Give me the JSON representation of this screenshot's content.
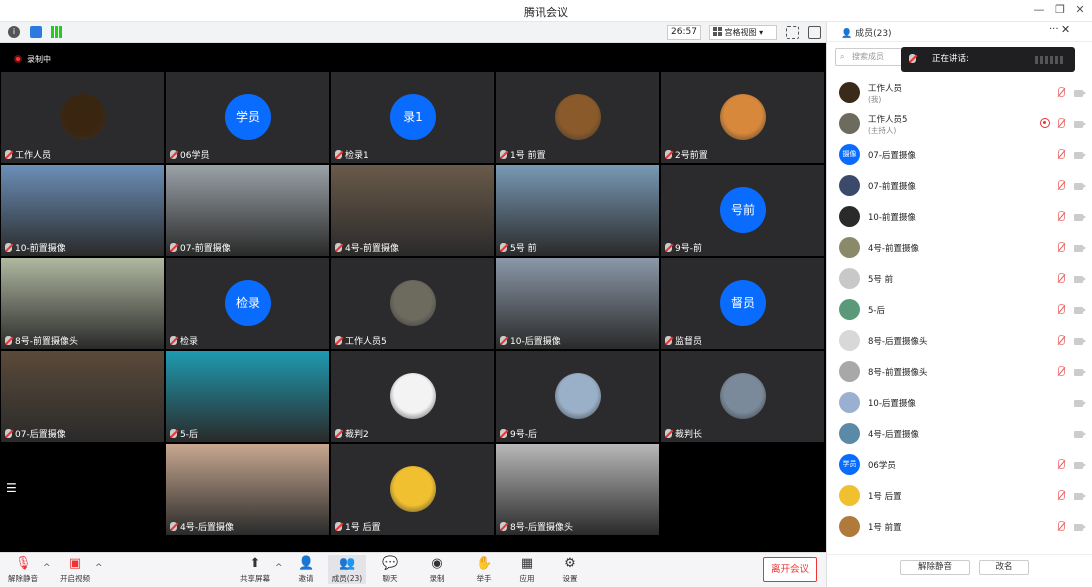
{
  "window": {
    "title": "腾讯会议"
  },
  "toolbar": {
    "timer": "26:57",
    "view_label": "宫格视图"
  },
  "recording": {
    "label": "录制中"
  },
  "tiles": [
    {
      "name": "工作人员",
      "kind": "photo",
      "color": "#3a2510"
    },
    {
      "name": "06学员",
      "kind": "circle",
      "text": "学员"
    },
    {
      "name": "检录1",
      "kind": "circle",
      "text": "录1"
    },
    {
      "name": "1号 前置",
      "kind": "photo",
      "color": "#8a5a2a"
    },
    {
      "name": "2号前置",
      "kind": "photo",
      "color": "#d8883a"
    },
    {
      "name": "10-前置摄像",
      "kind": "video",
      "color": "#6b8fb8"
    },
    {
      "name": "07-前置摄像",
      "kind": "video",
      "color": "#9aa2a8"
    },
    {
      "name": "4号-前置摄像",
      "kind": "video",
      "color": "#6a5a4a"
    },
    {
      "name": "5号  前",
      "kind": "video",
      "color": "#7899b5"
    },
    {
      "name": "9号-前",
      "kind": "circle",
      "text": "号前"
    },
    {
      "name": "8号-前置摄像头",
      "kind": "video",
      "color": "#b0b8a0"
    },
    {
      "name": "检录",
      "kind": "circle",
      "text": "检录"
    },
    {
      "name": "工作人员5",
      "kind": "photo",
      "color": "#6d6a5e"
    },
    {
      "name": "10-后置摄像",
      "kind": "video",
      "color": "#8a98a8"
    },
    {
      "name": "监督员",
      "kind": "circle",
      "text": "督员"
    },
    {
      "name": "07-后置摄像",
      "kind": "video",
      "color": "#5a4a3a"
    },
    {
      "name": "5-后",
      "kind": "video",
      "color": "#1e9ab0"
    },
    {
      "name": "裁判2",
      "kind": "photo",
      "color": "#f3f3f3"
    },
    {
      "name": "9号-后",
      "kind": "photo",
      "color": "#9ab0c8"
    },
    {
      "name": "裁判长",
      "kind": "photo",
      "color": "#7a8a9a"
    },
    {
      "name": "",
      "kind": "empty"
    },
    {
      "name": "4号-后置摄像",
      "kind": "video",
      "color": "#c8a890"
    },
    {
      "name": "1号 后置",
      "kind": "photo",
      "color": "#f0c030"
    },
    {
      "name": "8号-后置摄像头",
      "kind": "video",
      "color": "#b8b8b8"
    },
    {
      "name": "",
      "kind": "empty"
    }
  ],
  "bottom": {
    "unmute": "解除静音",
    "video": "开启视频",
    "share": "共享屏幕",
    "invite": "邀请",
    "members": "成员(23)",
    "chat": "聊天",
    "record": "录制",
    "raise": "举手",
    "apps": "应用",
    "settings": "设置",
    "leave": "离开会议"
  },
  "panel": {
    "title": "成员(23)",
    "search_placeholder": "搜索成员",
    "speaking": "正在讲话:",
    "members": [
      {
        "name": "工作人员",
        "role": "(我)",
        "avatar": "#3a2a1a"
      },
      {
        "name": "工作人员5",
        "role": "(主持人)",
        "avatar": "#6d6a5e"
      },
      {
        "name": "07-后置摄像",
        "role": "",
        "avatar": "#0a6cff",
        "text": "摄像"
      },
      {
        "name": "07-前置摄像",
        "role": "",
        "avatar": "#3b4a6a"
      },
      {
        "name": "10-前置摄像",
        "role": "",
        "avatar": "#2a2a2a"
      },
      {
        "name": "4号-前置摄像",
        "role": "",
        "avatar": "#8a8a6a"
      },
      {
        "name": "5号  前",
        "role": "",
        "avatar": "#c8c8c8"
      },
      {
        "name": "5-后",
        "role": "",
        "avatar": "#5a9a7a"
      },
      {
        "name": "8号-后置摄像头",
        "role": "",
        "avatar": "#d8d8d8"
      },
      {
        "name": "8号-前置摄像头",
        "role": "",
        "avatar": "#a8a8a8"
      },
      {
        "name": "10-后置摄像",
        "role": "",
        "avatar": "#9ab0d0"
      },
      {
        "name": "4号-后置摄像",
        "role": "",
        "avatar": "#5a8aa8"
      },
      {
        "name": "06学员",
        "role": "",
        "avatar": "#0a6cff",
        "text": "学员"
      },
      {
        "name": "1号 后置",
        "role": "",
        "avatar": "#f0c030"
      },
      {
        "name": "1号 前置",
        "role": "",
        "avatar": "#b07a3a"
      }
    ],
    "unmute_all": "解除静音",
    "rename": "改名"
  }
}
